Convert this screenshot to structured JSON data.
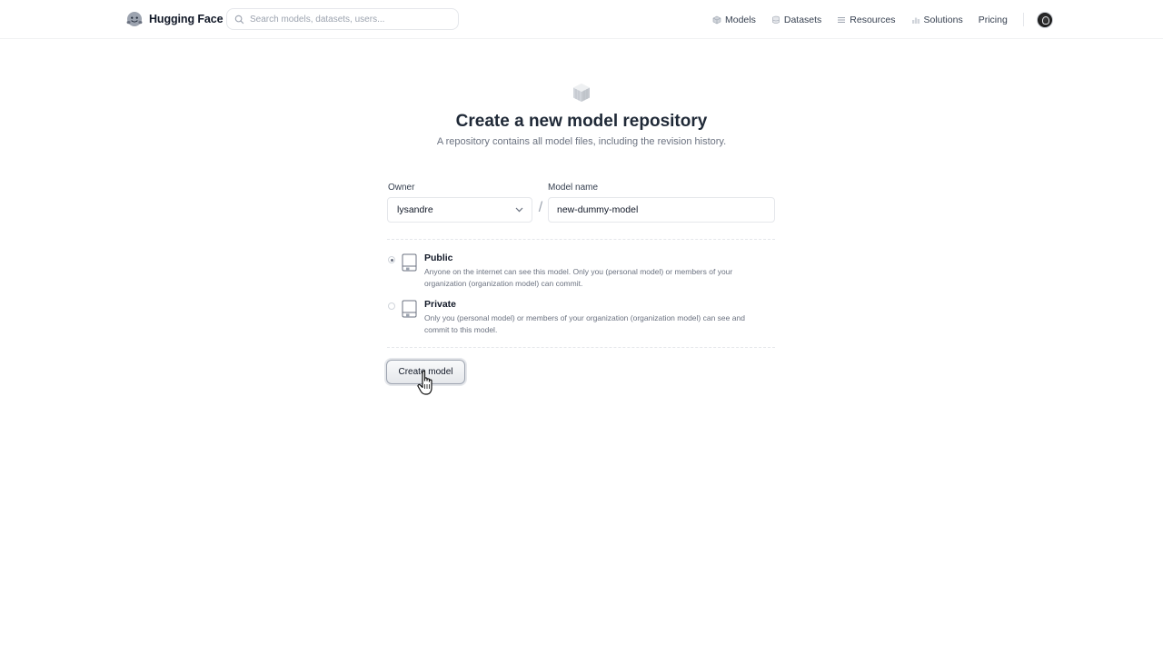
{
  "header": {
    "brand": "Hugging Face",
    "search_placeholder": "Search models, datasets, users...",
    "nav": [
      {
        "label": "Models",
        "icon": "models-icon"
      },
      {
        "label": "Datasets",
        "icon": "datasets-icon"
      },
      {
        "label": "Resources",
        "icon": "resources-icon"
      },
      {
        "label": "Solutions",
        "icon": "solutions-icon"
      },
      {
        "label": "Pricing",
        "icon": null
      }
    ]
  },
  "page": {
    "title": "Create a new model repository",
    "subtitle": "A repository contains all model files, including the revision history."
  },
  "form": {
    "owner_label": "Owner",
    "owner_value": "lysandre",
    "separator": "/",
    "model_name_label": "Model name",
    "model_name_value": "new-dummy-model",
    "visibility": {
      "selected": "Public",
      "options": [
        {
          "title": "Public",
          "description": "Anyone on the internet can see this model. Only you (personal model) or members of your organization (organization model) can commit."
        },
        {
          "title": "Private",
          "description": "Only you (personal model) or members of your organization (organization model) can see and commit to this model."
        }
      ]
    },
    "submit_label": "Create model"
  },
  "colors": {
    "text": "#111827",
    "muted": "#6b7280",
    "border": "#e5e7eb"
  }
}
